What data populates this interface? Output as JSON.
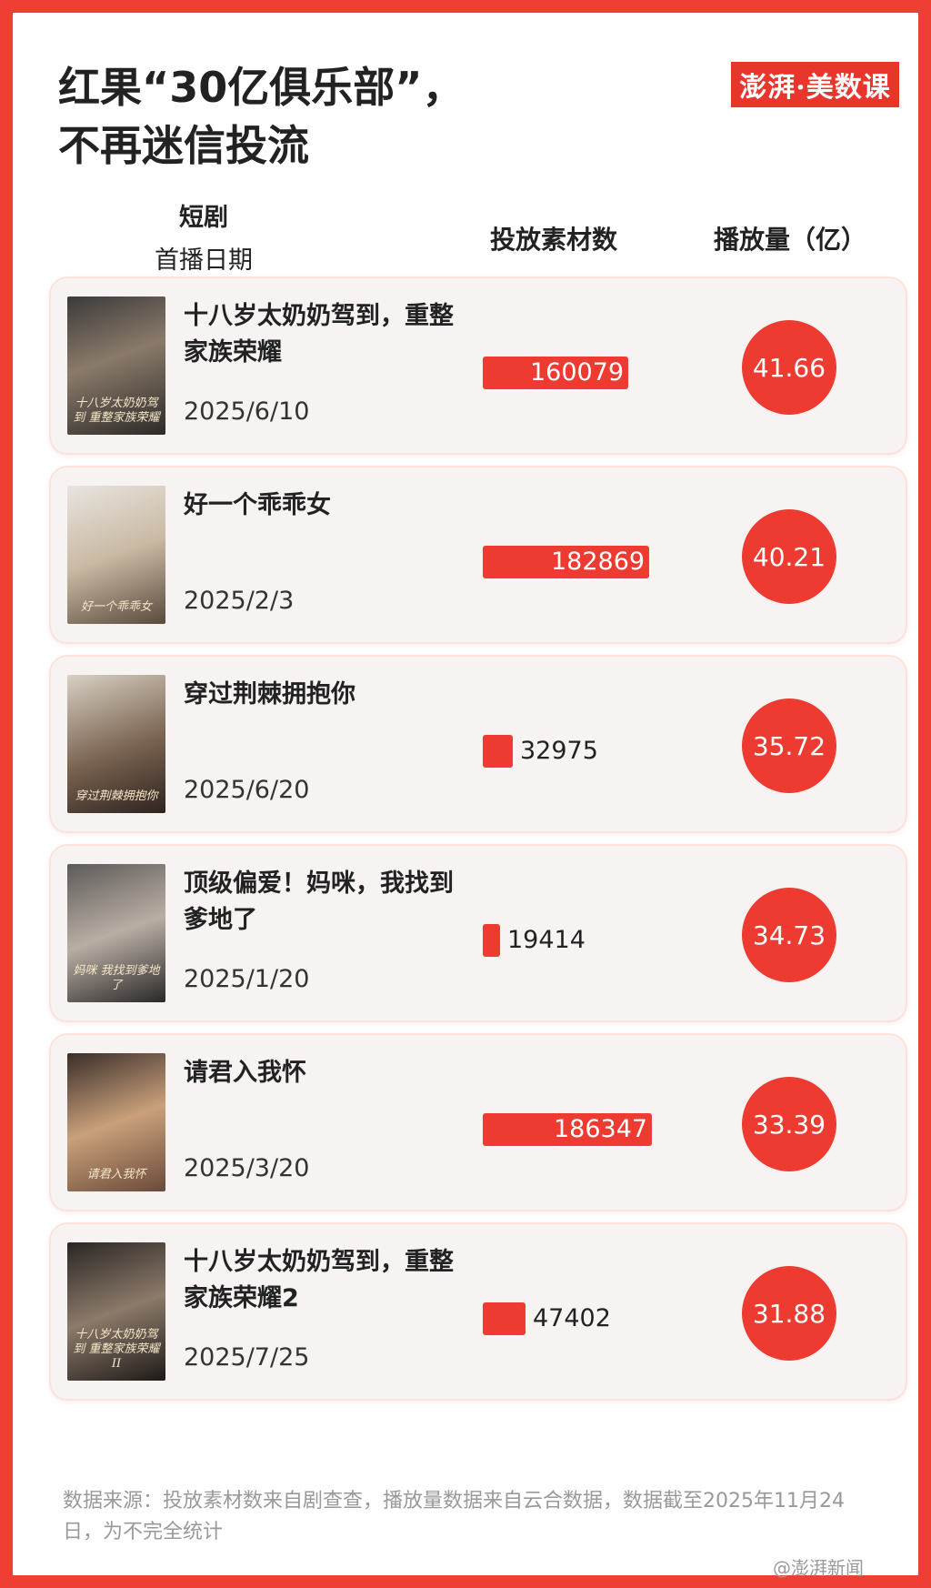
{
  "title_line1": "红果“30亿俱乐部”，",
  "title_line2": "不再迷信投流",
  "logo": "澎湃·美数课",
  "headers": {
    "drama": "短剧",
    "date": "首播日期",
    "materials": "投放素材数",
    "plays": "播放量（亿）"
  },
  "rows": [
    {
      "name": "十八岁太奶奶驾到，重整家族荣耀",
      "date": "2025/6/10",
      "materials": "160079",
      "plays": "41.66",
      "poster_caption": "十八岁太奶奶驾到 重整家族荣耀"
    },
    {
      "name": "好一个乖乖女",
      "date": "2025/2/3",
      "materials": "182869",
      "plays": "40.21",
      "poster_caption": "好一个乖乖女"
    },
    {
      "name": "穿过荆棘拥抱你",
      "date": "2025/6/20",
      "materials": "32975",
      "plays": "35.72",
      "poster_caption": "穿过荆棘拥抱你"
    },
    {
      "name": "顶级偏爱！妈咪，我找到爹地了",
      "date": "2025/1/20",
      "materials": "19414",
      "plays": "34.73",
      "poster_caption": "妈咪 我找到爹地了"
    },
    {
      "name": "请君入我怀",
      "date": "2025/3/20",
      "materials": "186347",
      "plays": "33.39",
      "poster_caption": "请君入我怀"
    },
    {
      "name": "十八岁太奶奶驾到，重整家族荣耀2",
      "date": "2025/7/25",
      "materials": "47402",
      "plays": "31.88",
      "poster_caption": "十八岁太奶奶驾到 重整家族荣耀II"
    }
  ],
  "source_text": "数据来源：投放素材数来自剧查查，播放量数据来自云合数据，数据截至2025年11月24日，为不完全统计",
  "watermark": "@澎湃新闻",
  "colors": {
    "accent": "#ee3b31",
    "background": "#ef3e33",
    "card": "#f6f3f2"
  },
  "chart_data": {
    "type": "bar",
    "title": "红果“30亿俱乐部”，不再迷信投流",
    "categories": [
      "十八岁太奶奶驾到，重整家族荣耀",
      "好一个乖乖女",
      "穿过荆棘拥抱你",
      "顶级偏爱！妈咪，我找到爹地了",
      "请君入我怀",
      "十八岁太奶奶驾到，重整家族荣耀2"
    ],
    "series": [
      {
        "name": "投放素材数",
        "values": [
          160079,
          182869,
          32975,
          19414,
          186347,
          47402
        ]
      },
      {
        "name": "播放量（亿）",
        "values": [
          41.66,
          40.21,
          35.72,
          34.73,
          33.39,
          31.88
        ]
      }
    ],
    "dates": [
      "2025/6/10",
      "2025/2/3",
      "2025/6/20",
      "2025/1/20",
      "2025/3/20",
      "2025/7/25"
    ]
  }
}
